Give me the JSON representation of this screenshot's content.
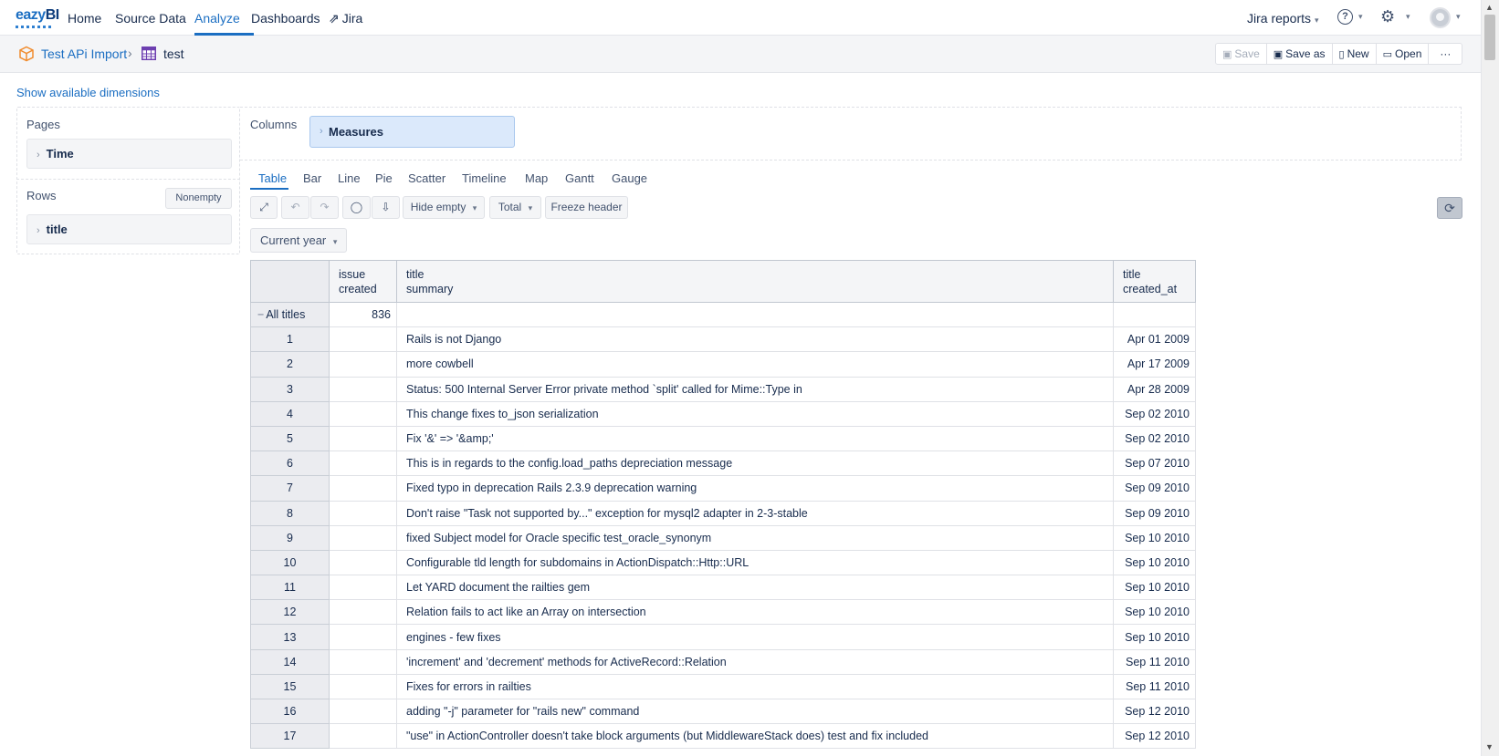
{
  "nav": {
    "logo_prefix": "eazy",
    "logo_suffix": "BI",
    "items": [
      {
        "label": "Home"
      },
      {
        "label": "Source Data"
      },
      {
        "label": "Analyze"
      },
      {
        "label": "Dashboards"
      },
      {
        "label": "Jira"
      }
    ],
    "active": "Analyze",
    "jira_reports": "Jira reports",
    "help": "?"
  },
  "breadcrumb": {
    "account": "Test APi Import",
    "separator": "›",
    "report": "test"
  },
  "report_toolbar": {
    "save": "Save",
    "save_as": "Save as",
    "new": "New",
    "open": "Open",
    "more": "···"
  },
  "layout": {
    "show_dimensions": "Show available dimensions",
    "pages_label": "Pages",
    "pages_dimension": "Time",
    "rows_label": "Rows",
    "nonempty": "Nonempty",
    "rows_dimension": "title",
    "columns_label": "Columns",
    "columns_dimension": "Measures"
  },
  "viz_tabs": {
    "items": [
      "Table",
      "Bar",
      "Line",
      "Pie",
      "Scatter",
      "Timeline",
      "Map",
      "Gantt",
      "Gauge"
    ],
    "active": "Table"
  },
  "table_toolbar": {
    "hide_empty": "Hide empty",
    "total": "Total",
    "freeze_header": "Freeze header",
    "current_year": "Current year"
  },
  "table": {
    "columns": [
      {
        "line1": "issue",
        "line2": "created"
      },
      {
        "line1": "title",
        "line2": "summary"
      },
      {
        "line1": "title",
        "line2": "created_at"
      }
    ],
    "all_row": {
      "label": "All titles",
      "issue_created": "836",
      "summary": "",
      "created_at": ""
    },
    "rows": [
      {
        "id": "1",
        "issue_created": "",
        "summary": "Rails is not Django",
        "created_at": "Apr 01 2009"
      },
      {
        "id": "2",
        "issue_created": "",
        "summary": "more cowbell",
        "created_at": "Apr 17 2009"
      },
      {
        "id": "3",
        "issue_created": "",
        "summary": "Status: 500 Internal Server Error private method `split' called for Mime::Type in",
        "created_at": "Apr 28 2009"
      },
      {
        "id": "4",
        "issue_created": "",
        "summary": "This change fixes to_json serialization",
        "created_at": "Sep 02 2010"
      },
      {
        "id": "5",
        "issue_created": "",
        "summary": "Fix '&' => '&amp;'",
        "created_at": "Sep 02 2010"
      },
      {
        "id": "6",
        "issue_created": "",
        "summary": "This is in regards to the config.load_paths depreciation message",
        "created_at": "Sep 07 2010"
      },
      {
        "id": "7",
        "issue_created": "",
        "summary": "Fixed typo in deprecation Rails 2.3.9 deprecation warning",
        "created_at": "Sep 09 2010"
      },
      {
        "id": "8",
        "issue_created": "",
        "summary": "Don't raise \"Task not supported by...\" exception for mysql2 adapter in 2-3-stable",
        "created_at": "Sep 09 2010"
      },
      {
        "id": "9",
        "issue_created": "",
        "summary": "fixed Subject model for Oracle specific test_oracle_synonym",
        "created_at": "Sep 10 2010"
      },
      {
        "id": "10",
        "issue_created": "",
        "summary": "Configurable tld length for subdomains in ActionDispatch::Http::URL",
        "created_at": "Sep 10 2010"
      },
      {
        "id": "11",
        "issue_created": "",
        "summary": "Let YARD document the railties gem",
        "created_at": "Sep 10 2010"
      },
      {
        "id": "12",
        "issue_created": "",
        "summary": "Relation fails to act like an Array on intersection",
        "created_at": "Sep 10 2010"
      },
      {
        "id": "13",
        "issue_created": "",
        "summary": "engines - few fixes",
        "created_at": "Sep 10 2010"
      },
      {
        "id": "14",
        "issue_created": "",
        "summary": "'increment' and 'decrement' methods for ActiveRecord::Relation",
        "created_at": "Sep 11 2010"
      },
      {
        "id": "15",
        "issue_created": "",
        "summary": "Fixes for errors in railties",
        "created_at": "Sep 11 2010"
      },
      {
        "id": "16",
        "issue_created": "",
        "summary": "adding \"-j\" parameter for \"rails new\" command",
        "created_at": "Sep 12 2010"
      },
      {
        "id": "17",
        "issue_created": "",
        "summary": "\"use\" in ActionController doesn't take block arguments (but MiddlewareStack does) test and fix included",
        "created_at": "Sep 12 2010"
      }
    ]
  },
  "icons": {
    "cube": "cube-icon",
    "table": "table-icon",
    "gear": "gear-icon",
    "help": "help-icon",
    "avatar": "avatar-icon"
  },
  "colors": {
    "accent": "#1b6ec2",
    "measures_chip": "#dbe9fb",
    "header_bg": "#f4f5f7"
  }
}
